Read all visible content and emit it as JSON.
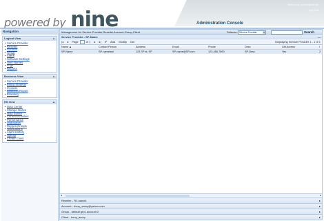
{
  "header": {
    "brand_prefix": "powered by",
    "brand_name": "nine",
    "console_title": "Administration Console",
    "welcome": "Welcome, admin@admin",
    "logout": "Log Out"
  },
  "nav": {
    "title": "Navigation",
    "panels": [
      {
        "title": "Logical View",
        "items": [
          "Service Provider",
          "Reseller",
          "Account",
          "Group",
          "Client",
          "Software Settings",
          "User Names",
          "Logs",
          "Reports"
        ]
      },
      {
        "title": "Business View",
        "items": [
          "Service Provider",
          "Billing Strategy",
          "Invoices",
          "Business Report",
          "Branding"
        ]
      },
      {
        "title": "HS View",
        "items": [
          "Data Center",
          "Storage Nodes",
          "Hold Server",
          "Current Activities",
          "Performance",
          "DiskStatus",
          "Replica Groups",
          "Notifications",
          "Alarm History",
          "Upload",
          "Create Client"
        ]
      }
    ]
  },
  "main": {
    "breadcrumb": "Management for Service Provider,Reseller,Account,Group,Client",
    "selector_label": "Selector:",
    "selector_value": "Service Provider",
    "search_label": "Search",
    "grid_title": "Service Provider - SP-Name",
    "toolbar": {
      "page_label": "Page",
      "page_value": "1",
      "of_label": "of 1",
      "add": "Add",
      "modify": "Modify",
      "del": "Del",
      "displaying": "Displaying Service Provider 1 - 1 of 1"
    },
    "columns": [
      "Name ▲",
      "Contact Person",
      "Address",
      "Email",
      "Phone",
      "Desc",
      "Uid Access",
      "I"
    ],
    "rows": [
      [
        "SP-Name",
        "SP-name­last",
        "123 SP st, SP",
        "SP-name@SP.com",
        "123-456-7890",
        "SP-Desc",
        "Yes",
        "2"
      ]
    ],
    "accordion": [
      "Reseller - R1-name1",
      "Account - horry_arvey@yahoo.com",
      "Group - default grp1 account 2",
      "Client - horry_arvey"
    ]
  }
}
